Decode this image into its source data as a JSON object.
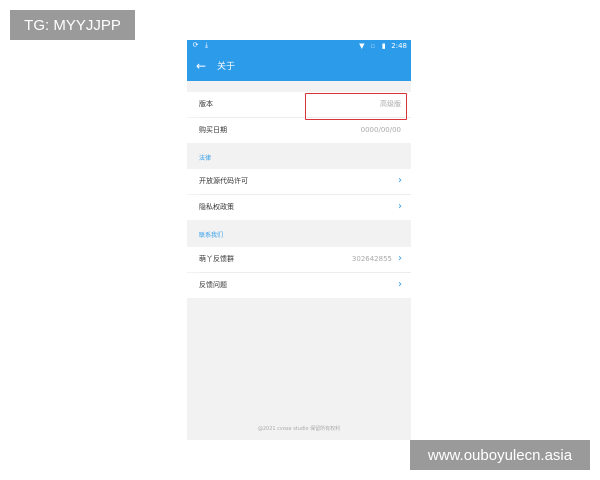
{
  "watermarks": {
    "top": "TG: MYYJJPP",
    "bottom": "www.ouboyulecn.asia"
  },
  "status_bar": {
    "time": "2:48",
    "icons_left": [
      "sync-icon",
      "download-icon"
    ],
    "icons_right": [
      "wifi-icon",
      "no-sim-icon",
      "battery-icon"
    ]
  },
  "app_bar": {
    "back_icon": "arrow-left-icon",
    "title": "关于"
  },
  "rows": {
    "version": {
      "label": "版本",
      "value": "高级版"
    },
    "purchase_date": {
      "label": "购买日期",
      "value": "0000/00/00"
    },
    "legal_header": "法律",
    "open_source": {
      "label": "开放源代码许可"
    },
    "privacy": {
      "label": "隐私权政策"
    },
    "contact_header": "联系我们",
    "feedback_group": {
      "label": "萌丫反馈群",
      "value": "302642855"
    },
    "feedback_issue": {
      "label": "反馈问题"
    }
  },
  "footer": "@2021 cvose studio 保留所有权利",
  "colors": {
    "accent": "#2b9bea",
    "highlight_border": "#d9343a",
    "background": "#f2f2f2"
  }
}
